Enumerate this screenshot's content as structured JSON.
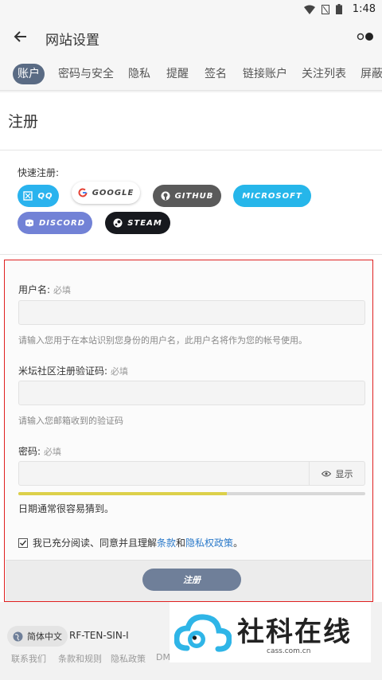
{
  "status_bar": {
    "time": "1:48",
    "icons": [
      "wifi-icon",
      "notification-icon",
      "battery-icon"
    ]
  },
  "app_bar": {
    "title": "网站设置",
    "back_icon": "arrow-left-icon",
    "menu_icon": "toggle-dot-icon"
  },
  "tabs": [
    {
      "label": "账户",
      "active": true
    },
    {
      "label": "密码与安全",
      "active": false
    },
    {
      "label": "隐私",
      "active": false
    },
    {
      "label": "提醒",
      "active": false
    },
    {
      "label": "签名",
      "active": false
    },
    {
      "label": "链接账户",
      "active": false
    },
    {
      "label": "关注列表",
      "active": false
    },
    {
      "label": "屏蔽",
      "active": false
    }
  ],
  "page": {
    "heading": "注册"
  },
  "quick_register": {
    "label": "快速注册:",
    "providers": [
      {
        "label": "QQ",
        "icon": "qq-icon",
        "bg": "#2ab3ee",
        "fg": "#ffffff"
      },
      {
        "label": "GOOGLE",
        "icon": "google-icon",
        "bg": "#ffffff",
        "fg": "#444444"
      },
      {
        "label": "GITHUB",
        "icon": "github-icon",
        "bg": "#5a5a5a",
        "fg": "#ffffff"
      },
      {
        "label": "MICROSOFT",
        "icon": "",
        "bg": "#26b6ea",
        "fg": "#ffffff"
      },
      {
        "label": "DISCORD",
        "icon": "discord-icon",
        "bg": "#7282d6",
        "fg": "#ffffff"
      },
      {
        "label": "STEAM",
        "icon": "steam-icon",
        "bg": "#17191e",
        "fg": "#ffffff"
      }
    ]
  },
  "form": {
    "username": {
      "label": "用户名:",
      "required": "必填",
      "value": "",
      "hint": "请输入您用于在本站识别您身份的用户名，此用户名将作为您的帐号使用。"
    },
    "code": {
      "label": "米坛社区注册验证码:",
      "required": "必填",
      "value": "",
      "hint": "请输入您邮箱收到的验证码"
    },
    "password": {
      "label": "密码:",
      "required": "必填",
      "value": "",
      "show_label": "显示",
      "strength_fraction": 0.6,
      "strength_text": "日期通常很容易猜到。"
    },
    "agree": {
      "checked": true,
      "text_before": "我已充分阅读、同意并且理解",
      "terms": "条款",
      "and": "和",
      "privacy": "隐私权政策",
      "end": "。"
    },
    "submit_label": "注册"
  },
  "footer": {
    "language": "简体中文",
    "code": "RF-TEN-SIN-I",
    "links": [
      "联系我们",
      "条款和规则",
      "隐私政策",
      "DM"
    ]
  },
  "watermark": {
    "title": "社科在线",
    "subtitle": "cass.com.cn"
  },
  "colors": {
    "accent": "#5a6b84",
    "error_border": "#e02020",
    "link": "#2a79c9"
  }
}
